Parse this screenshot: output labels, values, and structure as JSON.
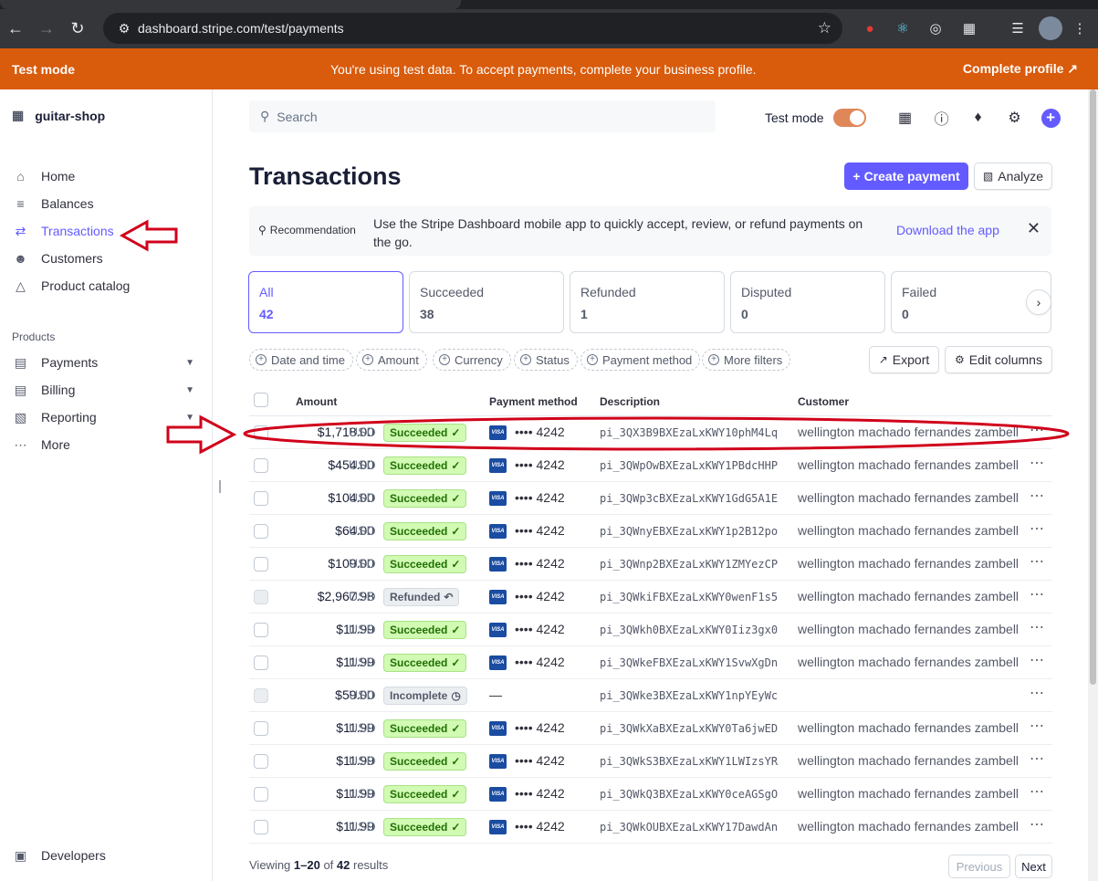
{
  "browser": {
    "url": "dashboard.stripe.com/test/payments"
  },
  "banner": {
    "left": "Test mode",
    "center": "You're using test data. To accept payments, complete your business profile.",
    "right": "Complete profile ↗"
  },
  "sidebar": {
    "account": "guitar-shop",
    "items": [
      {
        "label": "Home",
        "icon": "home-icon"
      },
      {
        "label": "Balances",
        "icon": "balances-icon"
      },
      {
        "label": "Transactions",
        "icon": "transactions-icon",
        "active": true
      },
      {
        "label": "Customers",
        "icon": "customers-icon"
      },
      {
        "label": "Product catalog",
        "icon": "product-catalog-icon"
      }
    ],
    "products_label": "Products",
    "product_items": [
      {
        "label": "Payments",
        "icon": "payments-icon"
      },
      {
        "label": "Billing",
        "icon": "billing-icon"
      },
      {
        "label": "Reporting",
        "icon": "reporting-icon"
      },
      {
        "label": "More",
        "icon": "more-icon"
      }
    ],
    "developers": "Developers"
  },
  "header": {
    "search_placeholder": "Search",
    "test_mode_label": "Test mode"
  },
  "page": {
    "title": "Transactions",
    "create_payment": "Create payment",
    "analyze": "Analyze"
  },
  "recommendation": {
    "label": "Recommendation",
    "text": "Use the Stripe Dashboard mobile app to quickly accept, review, or refund payments on the go.",
    "link": "Download the app"
  },
  "stats": [
    {
      "label": "All",
      "value": "42",
      "active": true
    },
    {
      "label": "Succeeded",
      "value": "38"
    },
    {
      "label": "Refunded",
      "value": "1"
    },
    {
      "label": "Disputed",
      "value": "0"
    },
    {
      "label": "Failed",
      "value": "0"
    }
  ],
  "filters": [
    "Date and time",
    "Amount",
    "Currency",
    "Status",
    "Payment method",
    "More filters"
  ],
  "actions": {
    "export": "Export",
    "edit_columns": "Edit columns"
  },
  "table": {
    "headers": {
      "amount": "Amount",
      "payment_method": "Payment method",
      "description": "Description",
      "customer": "Customer"
    },
    "rows": [
      {
        "amount": "$1,718.00",
        "currency": "USD",
        "status": "Succeeded",
        "last4": "•••• 4242",
        "description": "pi_3QX3B9BXEzaLxKWY10phM4Lq",
        "customer": "wellington machado fernandes zambelli"
      },
      {
        "amount": "$454.00",
        "currency": "USD",
        "status": "Succeeded",
        "last4": "•••• 4242",
        "description": "pi_3QWpOwBXEzaLxKWY1PBdcHHP",
        "customer": "wellington machado fernandes zambelli"
      },
      {
        "amount": "$104.00",
        "currency": "USD",
        "status": "Succeeded",
        "last4": "•••• 4242",
        "description": "pi_3QWp3cBXEzaLxKWY1GdG5A1E",
        "customer": "wellington machado fernandes zambelli"
      },
      {
        "amount": "$64.00",
        "currency": "USD",
        "status": "Succeeded",
        "last4": "•••• 4242",
        "description": "pi_3QWnyEBXEzaLxKWY1p2B12po",
        "customer": "wellington machado fernandes zambelli"
      },
      {
        "amount": "$109.00",
        "currency": "USD",
        "status": "Succeeded",
        "last4": "•••• 4242",
        "description": "pi_3QWnp2BXEzaLxKWY1ZMYezCP",
        "customer": "wellington machado fernandes zambelli"
      },
      {
        "amount": "$2,967.98",
        "currency": "USD",
        "status": "Refunded",
        "last4": "•••• 4242",
        "description": "pi_3QWkiFBXEzaLxKWY0wenF1s5",
        "customer": "wellington machado fernandes zambelli"
      },
      {
        "amount": "$11.99",
        "currency": "USD",
        "status": "Succeeded",
        "last4": "•••• 4242",
        "description": "pi_3QWkh0BXEzaLxKWY0Iiz3gx0",
        "customer": "wellington machado fernandes zambelli"
      },
      {
        "amount": "$11.99",
        "currency": "USD",
        "status": "Succeeded",
        "last4": "•••• 4242",
        "description": "pi_3QWkeFBXEzaLxKWY1SvwXgDn",
        "customer": "wellington machado fernandes zambelli"
      },
      {
        "amount": "$59.00",
        "currency": "USD",
        "status": "Incomplete",
        "last4": "—",
        "description": "pi_3QWke3BXEzaLxKWY1npYEyWc",
        "customer": ""
      },
      {
        "amount": "$11.99",
        "currency": "USD",
        "status": "Succeeded",
        "last4": "•••• 4242",
        "description": "pi_3QWkXaBXEzaLxKWY0Ta6jwED",
        "customer": "wellington machado fernandes zambelli"
      },
      {
        "amount": "$11.99",
        "currency": "USD",
        "status": "Succeeded",
        "last4": "•••• 4242",
        "description": "pi_3QWkS3BXEzaLxKWY1LWIzsYR",
        "customer": "wellington machado fernandes zambelli"
      },
      {
        "amount": "$11.99",
        "currency": "USD",
        "status": "Succeeded",
        "last4": "•••• 4242",
        "description": "pi_3QWkQ3BXEzaLxKWY0ceAGSgO",
        "customer": "wellington machado fernandes zambelli"
      },
      {
        "amount": "$11.99",
        "currency": "USD",
        "status": "Succeeded",
        "last4": "•••• 4242",
        "description": "pi_3QWkOUBXEzaLxKWY17DawdAn",
        "customer": "wellington machado fernandes zambelli"
      }
    ]
  },
  "pagination": {
    "viewing_prefix": "Viewing ",
    "range": "1–20",
    "of": " of ",
    "total": "42",
    "suffix": " results",
    "previous": "Previous",
    "next": "Next"
  },
  "colors": {
    "accent": "#635bff",
    "banner": "#d95b0c",
    "annotation": "#d0021b"
  }
}
